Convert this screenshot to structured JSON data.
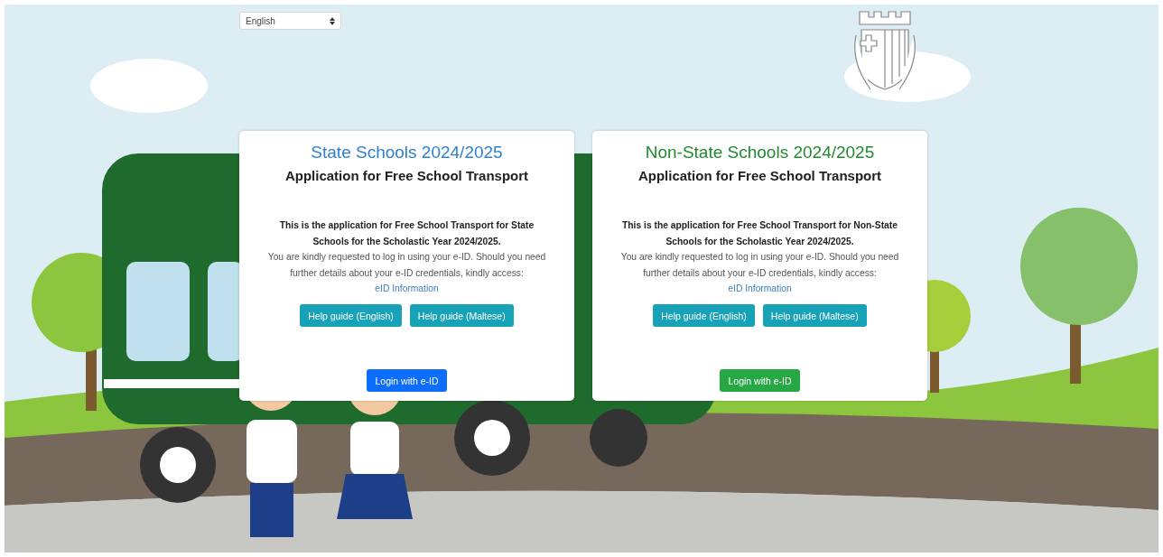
{
  "language_select": {
    "value": "English"
  },
  "cards": [
    {
      "kind": "state",
      "title": "State Schools 2024/2025",
      "subtitle": "Application for Free School Transport",
      "intro": "This is the application for Free School Transport for State Schools for the Scholastic Year 2024/2025.",
      "body": "You are kindly requested to log in using your e-ID. Should you need further details about your e-ID credentials, kindly access:",
      "link": "eID Information",
      "help_buttons": [
        "Help guide (English)",
        "Help guide (Maltese)"
      ],
      "login_button": "Login with e-ID"
    },
    {
      "kind": "non_state",
      "title": "Non-State Schools 2024/2025",
      "subtitle": "Application for Free School Transport",
      "intro": "This is the application for Free School Transport for Non-State Schools for the Scholastic Year 2024/2025.",
      "body": "You are kindly requested to log in using your e-ID. Should you need further details about your e-ID credentials, kindly access:",
      "link": "eID Information",
      "help_buttons": [
        "Help guide (English)",
        "Help guide (Maltese)"
      ],
      "login_button": "Login with e-ID"
    }
  ]
}
